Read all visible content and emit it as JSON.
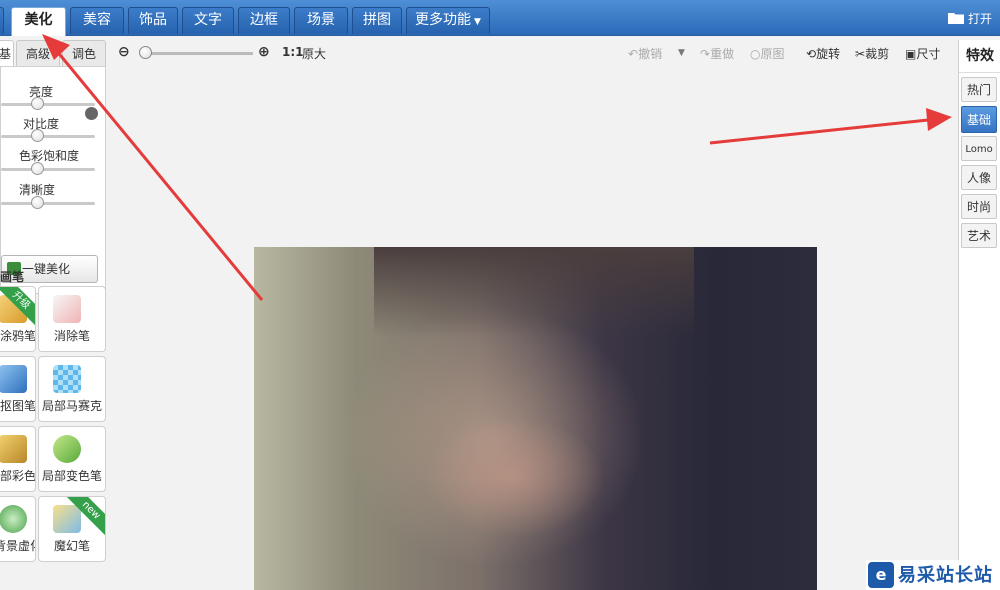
{
  "topbar": {
    "tabs": [
      "美化",
      "美容",
      "饰品",
      "文字",
      "边框",
      "场景",
      "拼图",
      "更多功能"
    ],
    "open_label": "打开"
  },
  "left": {
    "subtabs": [
      "基础",
      "高级",
      "调色"
    ],
    "sliders": [
      {
        "label": "亮度",
        "value": 0.5
      },
      {
        "label": "对比度",
        "value": 0.5
      },
      {
        "label": "色彩饱和度",
        "value": 0.5
      },
      {
        "label": "清晰度",
        "value": 0.5
      }
    ],
    "one_click_label": "一键美化",
    "brush_title": "画笔",
    "tools": [
      {
        "label": "涂鸦笔",
        "badge": "升级"
      },
      {
        "label": "消除笔"
      },
      {
        "label": "抠图笔"
      },
      {
        "label": "局部马赛克"
      },
      {
        "label": "局部彩色笔"
      },
      {
        "label": "局部变色笔"
      },
      {
        "label": "背景虚化"
      },
      {
        "label": "魔幻笔",
        "badge": "new"
      }
    ]
  },
  "toolbar": {
    "zoom_ratio": "1:1",
    "original_size": "原大",
    "undo": "撤销",
    "redo": "重做",
    "original": "原图",
    "rotate": "旋转",
    "crop": "裁剪",
    "size": "尺寸"
  },
  "right": {
    "title": "特效",
    "tabs": [
      "热门",
      "基础",
      "Lomo",
      "人像",
      "时尚",
      "艺术"
    ],
    "active": "基础"
  },
  "watermark": "易采站长站",
  "colors": {
    "topbar": "#2f6fbe",
    "active_right_tab": "#3e80cf",
    "arrow": "#e53b3b"
  }
}
